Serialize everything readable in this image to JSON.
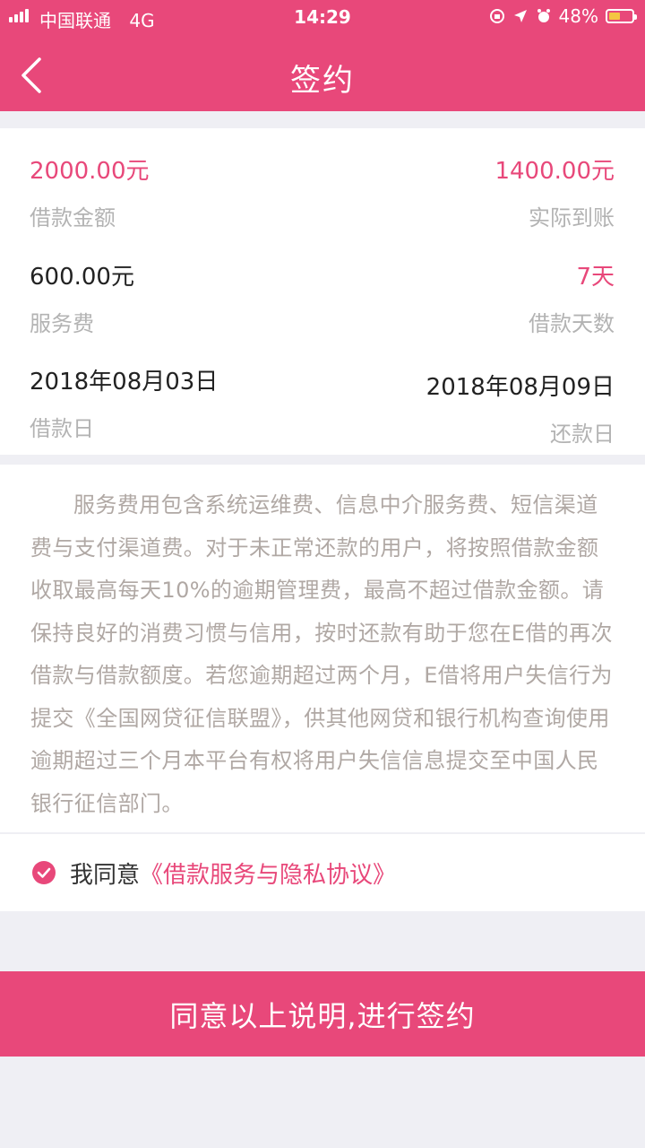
{
  "status_bar": {
    "carrier": "中国联通",
    "network": "4G",
    "time": "14:29",
    "battery": "48%",
    "battery_level": 0.48
  },
  "nav": {
    "title": "签约",
    "back_icon": "chevron-left-icon"
  },
  "loan": {
    "amount": {
      "value": "2000.00元",
      "label": "借款金额"
    },
    "received": {
      "value": "1400.00元",
      "label": "实际到账"
    },
    "fee": {
      "value": "600.00元",
      "label": "服务费"
    },
    "days": {
      "value": "7天",
      "label": "借款天数"
    },
    "loan_date": {
      "value": "2018年08月03日",
      "label": "借款日"
    },
    "repay_date": {
      "value": "2018年08月09日",
      "label": "还款日"
    }
  },
  "notice": {
    "text": "服务费用包含系统运维费、信息中介服务费、短信渠道费与支付渠道费。对于未正常还款的用户，将按照借款金额收取最高每天10%的逾期管理费，最高不超过借款金额。请保持良好的消费习惯与信用，按时还款有助于您在E借的再次借款与借款额度。若您逾期超过两个月，E借将用户失信行为提交《全国网贷征信联盟》，供其他网贷和银行机构查询使用逾期超过三个月本平台有权将用户失信信息提交至中国人民银行征信部门。"
  },
  "agreement": {
    "prefix": "我同意",
    "link": "《借款服务与隐私协议》",
    "checked": true
  },
  "actions": {
    "sign_label": "同意以上说明,进行签约"
  },
  "colors": {
    "accent": "#e8487a",
    "background": "#efeff4"
  }
}
